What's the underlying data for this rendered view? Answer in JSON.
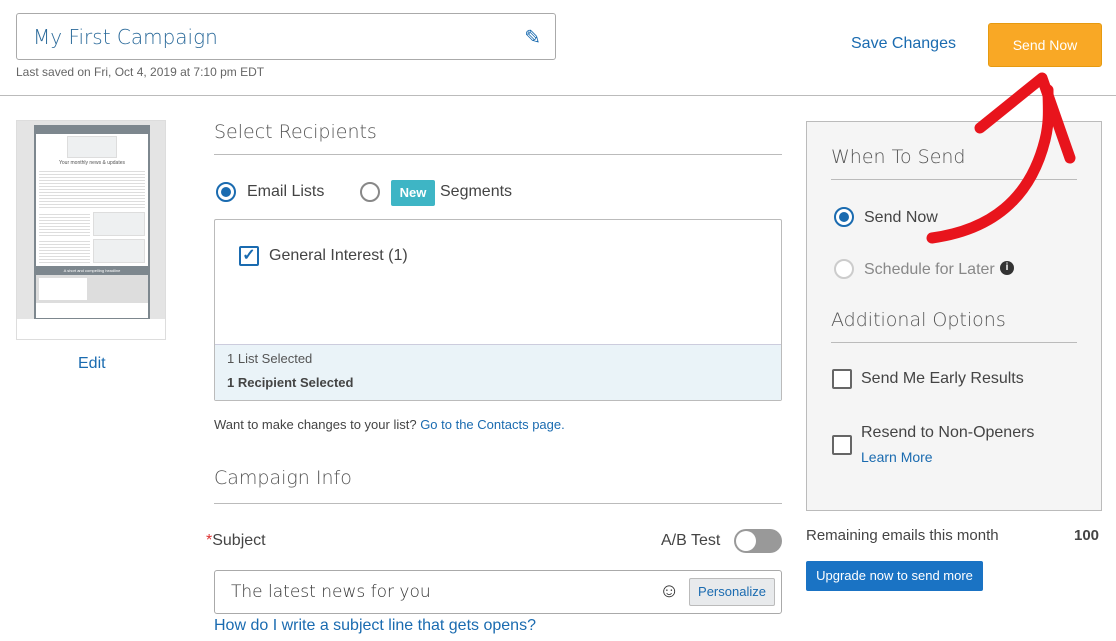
{
  "header": {
    "campaign_title": "My First Campaign",
    "last_saved": "Last saved on Fri, Oct 4, 2019 at 7:10 pm EDT",
    "save_changes": "Save Changes",
    "send_now": "Send Now"
  },
  "preview": {
    "headline": "Your monthly news & updates",
    "banner": "A short and compelling headline",
    "edit": "Edit"
  },
  "recipients": {
    "title": "Select Recipients",
    "email_lists": "Email Lists",
    "new_badge": "New",
    "segments": "Segments",
    "lists": [
      {
        "label": "General Interest (1)",
        "checked": true
      }
    ],
    "list_selected": "1 List Selected",
    "recipient_selected": "1 Recipient Selected",
    "change_prompt": "Want to make changes to your list?",
    "contacts_link": "Go to the Contacts page."
  },
  "campaign_info": {
    "title": "Campaign Info",
    "required_mark": "*",
    "subject_label": "Subject",
    "ab_test": "A/B Test",
    "ab_test_on": false,
    "subject_value": "The latest news for you",
    "personalize": "Personalize",
    "help_link": "How do I write a subject line that gets opens?"
  },
  "when_to_send": {
    "title": "When To Send",
    "send_now": "Send Now",
    "schedule": "Schedule for Later",
    "selected": "Send Now"
  },
  "additional": {
    "title": "Additional Options",
    "early_results": "Send Me Early Results",
    "resend": "Resend to Non-Openers",
    "learn_more": "Learn More"
  },
  "quota": {
    "label": "Remaining emails this month",
    "value": "100",
    "upgrade": "Upgrade now to send more"
  },
  "colors": {
    "accent": "#1a6bb0",
    "send_button": "#f9a825",
    "annotation_arrow": "#e8141c"
  }
}
